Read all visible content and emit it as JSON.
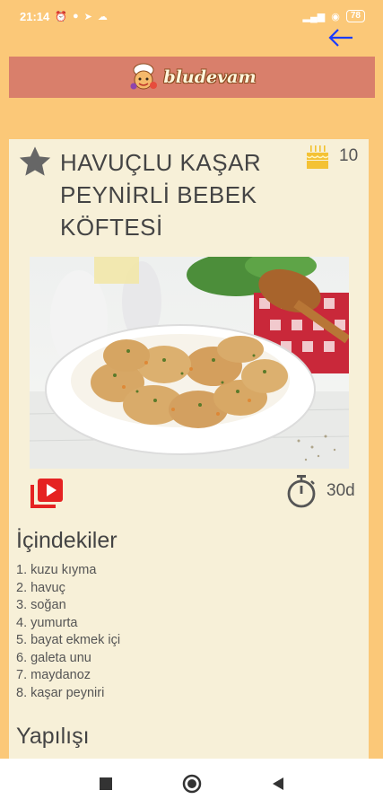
{
  "status_bar": {
    "time": "21:14",
    "battery": "78",
    "notification_icons": [
      "alarm-icon",
      "chat-icon",
      "telegram-icon",
      "cloud-icon"
    ]
  },
  "header": {
    "brand_name": "bludevam",
    "back_icon": "arrow-left-icon",
    "accent_color": "#1a3cff"
  },
  "recipe": {
    "title": "HAVUÇLU KAŞAR PEYNİRLİ BEBEK KÖFTESİ",
    "servings": "10",
    "time": "30d",
    "favorite_icon": "star-icon",
    "video_icon": "video-playlist-icon"
  },
  "ingredients": {
    "title": "İçindekiler",
    "items": [
      "1. kuzu kıyma",
      "2. havuç",
      "3. soğan",
      "4. yumurta",
      "5. bayat ekmek içi",
      "6. galeta unu",
      "7. maydanoz",
      "8. kaşar peyniri"
    ]
  },
  "preparation": {
    "title": "Yapılışı"
  },
  "colors": {
    "background": "#fbc878",
    "brand_bar": "#d97f6b",
    "card": "#f7f0d8",
    "video_red": "#e52222"
  }
}
